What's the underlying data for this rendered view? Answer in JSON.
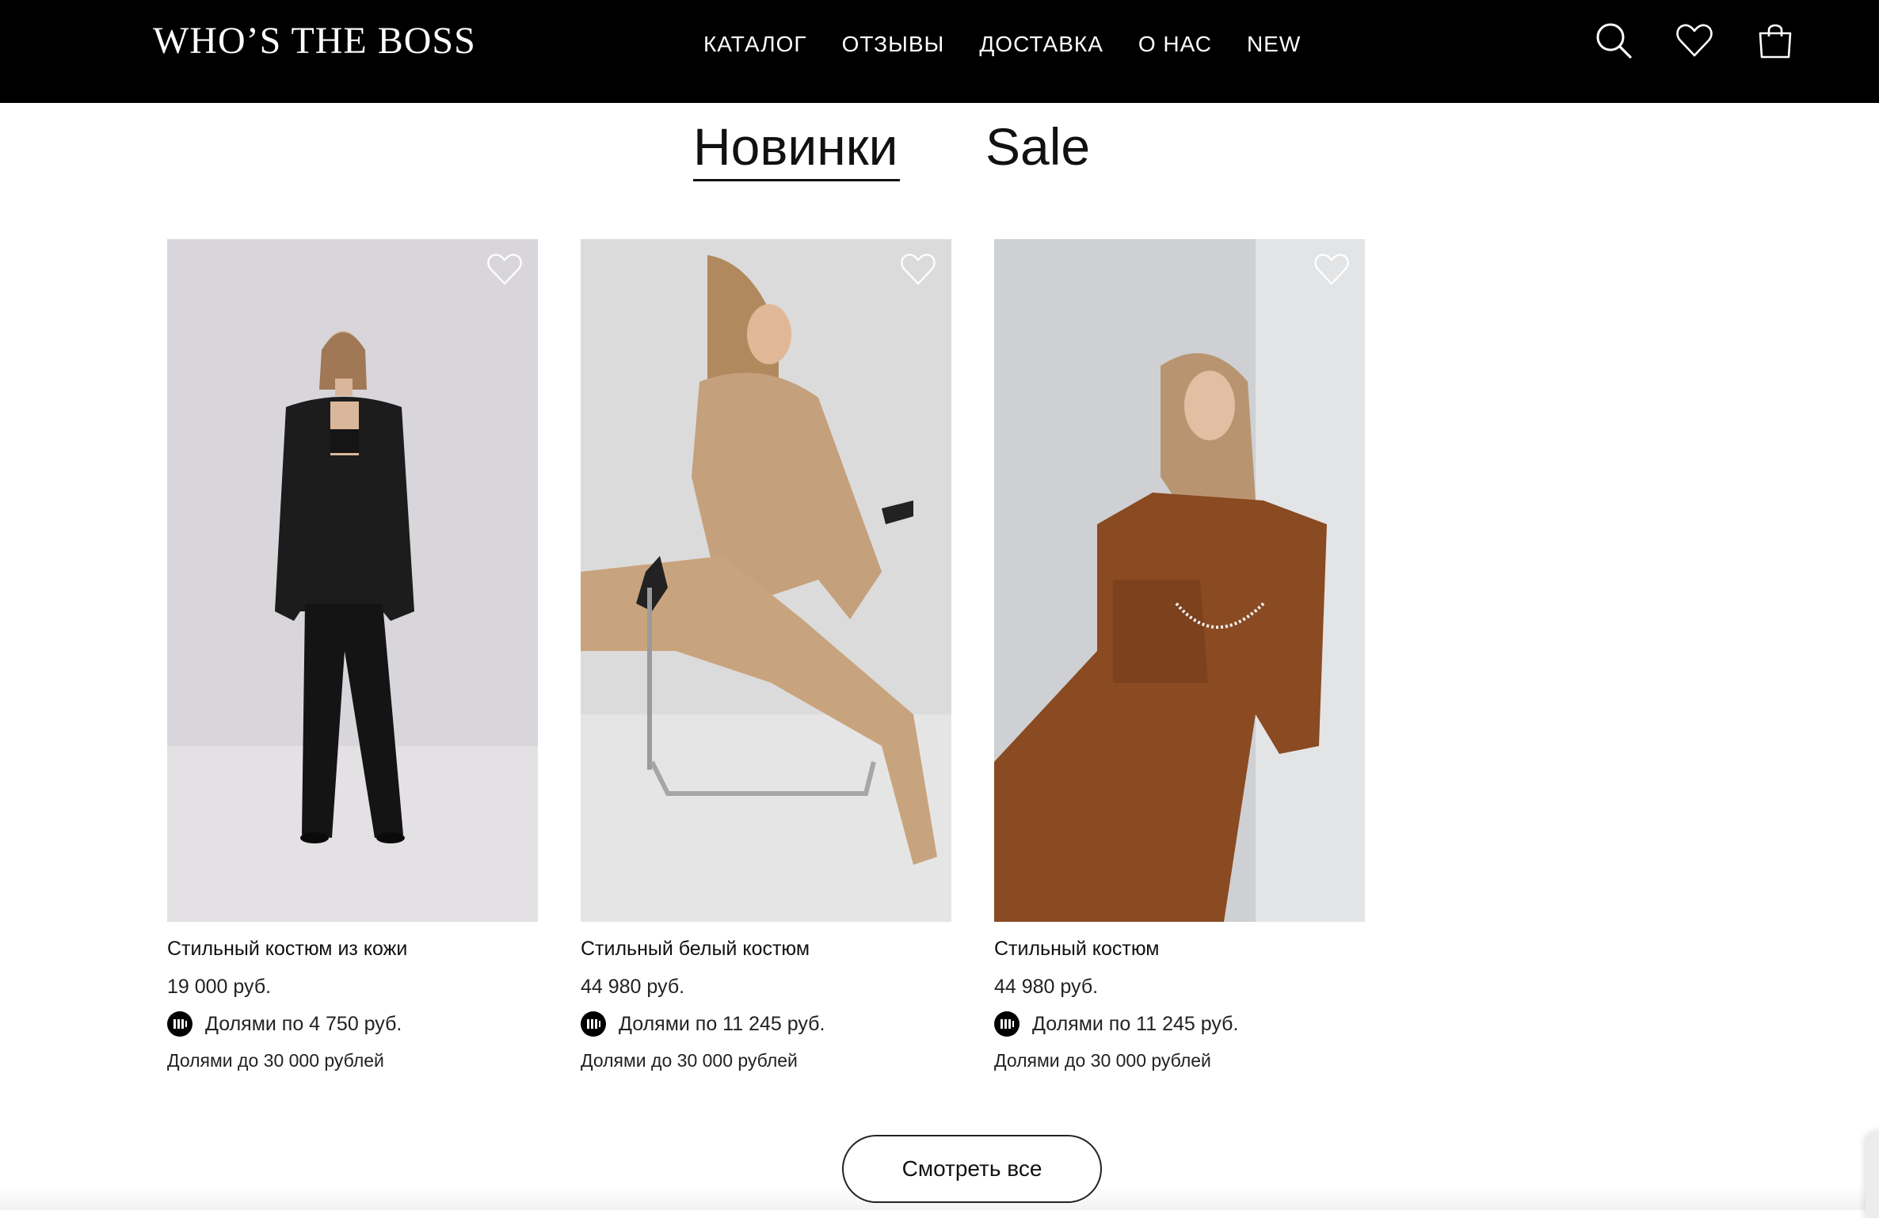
{
  "header": {
    "logo": "WHO’S THE BOSS",
    "nav": [
      "КАТАЛОГ",
      "ОТЗЫВЫ",
      "ДОСТАВКА",
      "О НАС",
      "NEW"
    ],
    "icons": [
      "search-icon",
      "heart-icon",
      "shopping-bag-icon"
    ]
  },
  "tabs": {
    "new": "Новинки",
    "sale": "Sale",
    "active": "new"
  },
  "products": [
    {
      "title": "Стильный костюм из кожи",
      "price": "19 000 руб.",
      "installment": "Долями по 4 750 руб.",
      "installment_note": "Долями до 30 000 рублей",
      "color": "#1a1a1a"
    },
    {
      "title": "Стильный белый костюм",
      "price": "44 980 руб.",
      "installment": "Долями по 11 245 руб.",
      "installment_note": "Долями до 30 000 рублей",
      "color": "#c4a07c"
    },
    {
      "title": "Стильный костюм",
      "price": "44 980 руб.",
      "installment": "Долями по 11 245 руб.",
      "installment_note": "Долями до 30 000 рублей",
      "color": "#8a4a22"
    }
  ],
  "view_all": "Смотреть все",
  "colors": {
    "header_bg": "#000000",
    "text": "#111111",
    "background": "#ffffff"
  }
}
